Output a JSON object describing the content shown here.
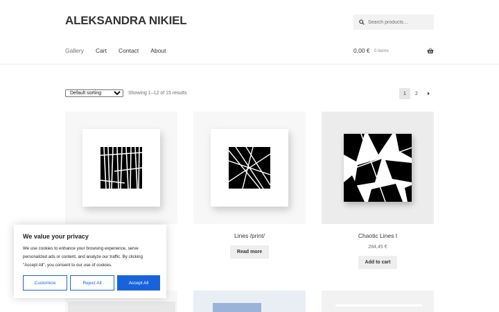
{
  "site": {
    "title": "ALEKSANDRA NIKIEL"
  },
  "search": {
    "placeholder": "Search products…",
    "icon": "search-icon"
  },
  "nav": {
    "items": [
      "Gallery",
      "Cart",
      "Contact",
      "About"
    ]
  },
  "cart": {
    "amount": "0,00 €",
    "items": "0 items",
    "icon": "basket-icon"
  },
  "toolbar": {
    "sort_selected": "Default sorting",
    "result_count": "Showing 1–12 of 15 results",
    "pages": [
      "1",
      "2"
    ],
    "next_icon": "next-arrow-icon"
  },
  "products": [
    {
      "title": "",
      "price": "",
      "button": ""
    },
    {
      "title": "Lines /print/",
      "price": "",
      "button": "Read more"
    },
    {
      "title": "Chaotic Lines I",
      "price": "284,45 €",
      "button": "Add to cart"
    }
  ],
  "cookie": {
    "heading": "We value your privacy",
    "body": "We use cookies to enhance your browsing experience, serve personalized ads or content, and analyze our traffic. By clicking \"Accept All\", you consent to our use of cookies.",
    "customize": "Customize",
    "reject": "Reject All",
    "accept": "Accept All",
    "accent_color": "#1863dc"
  }
}
